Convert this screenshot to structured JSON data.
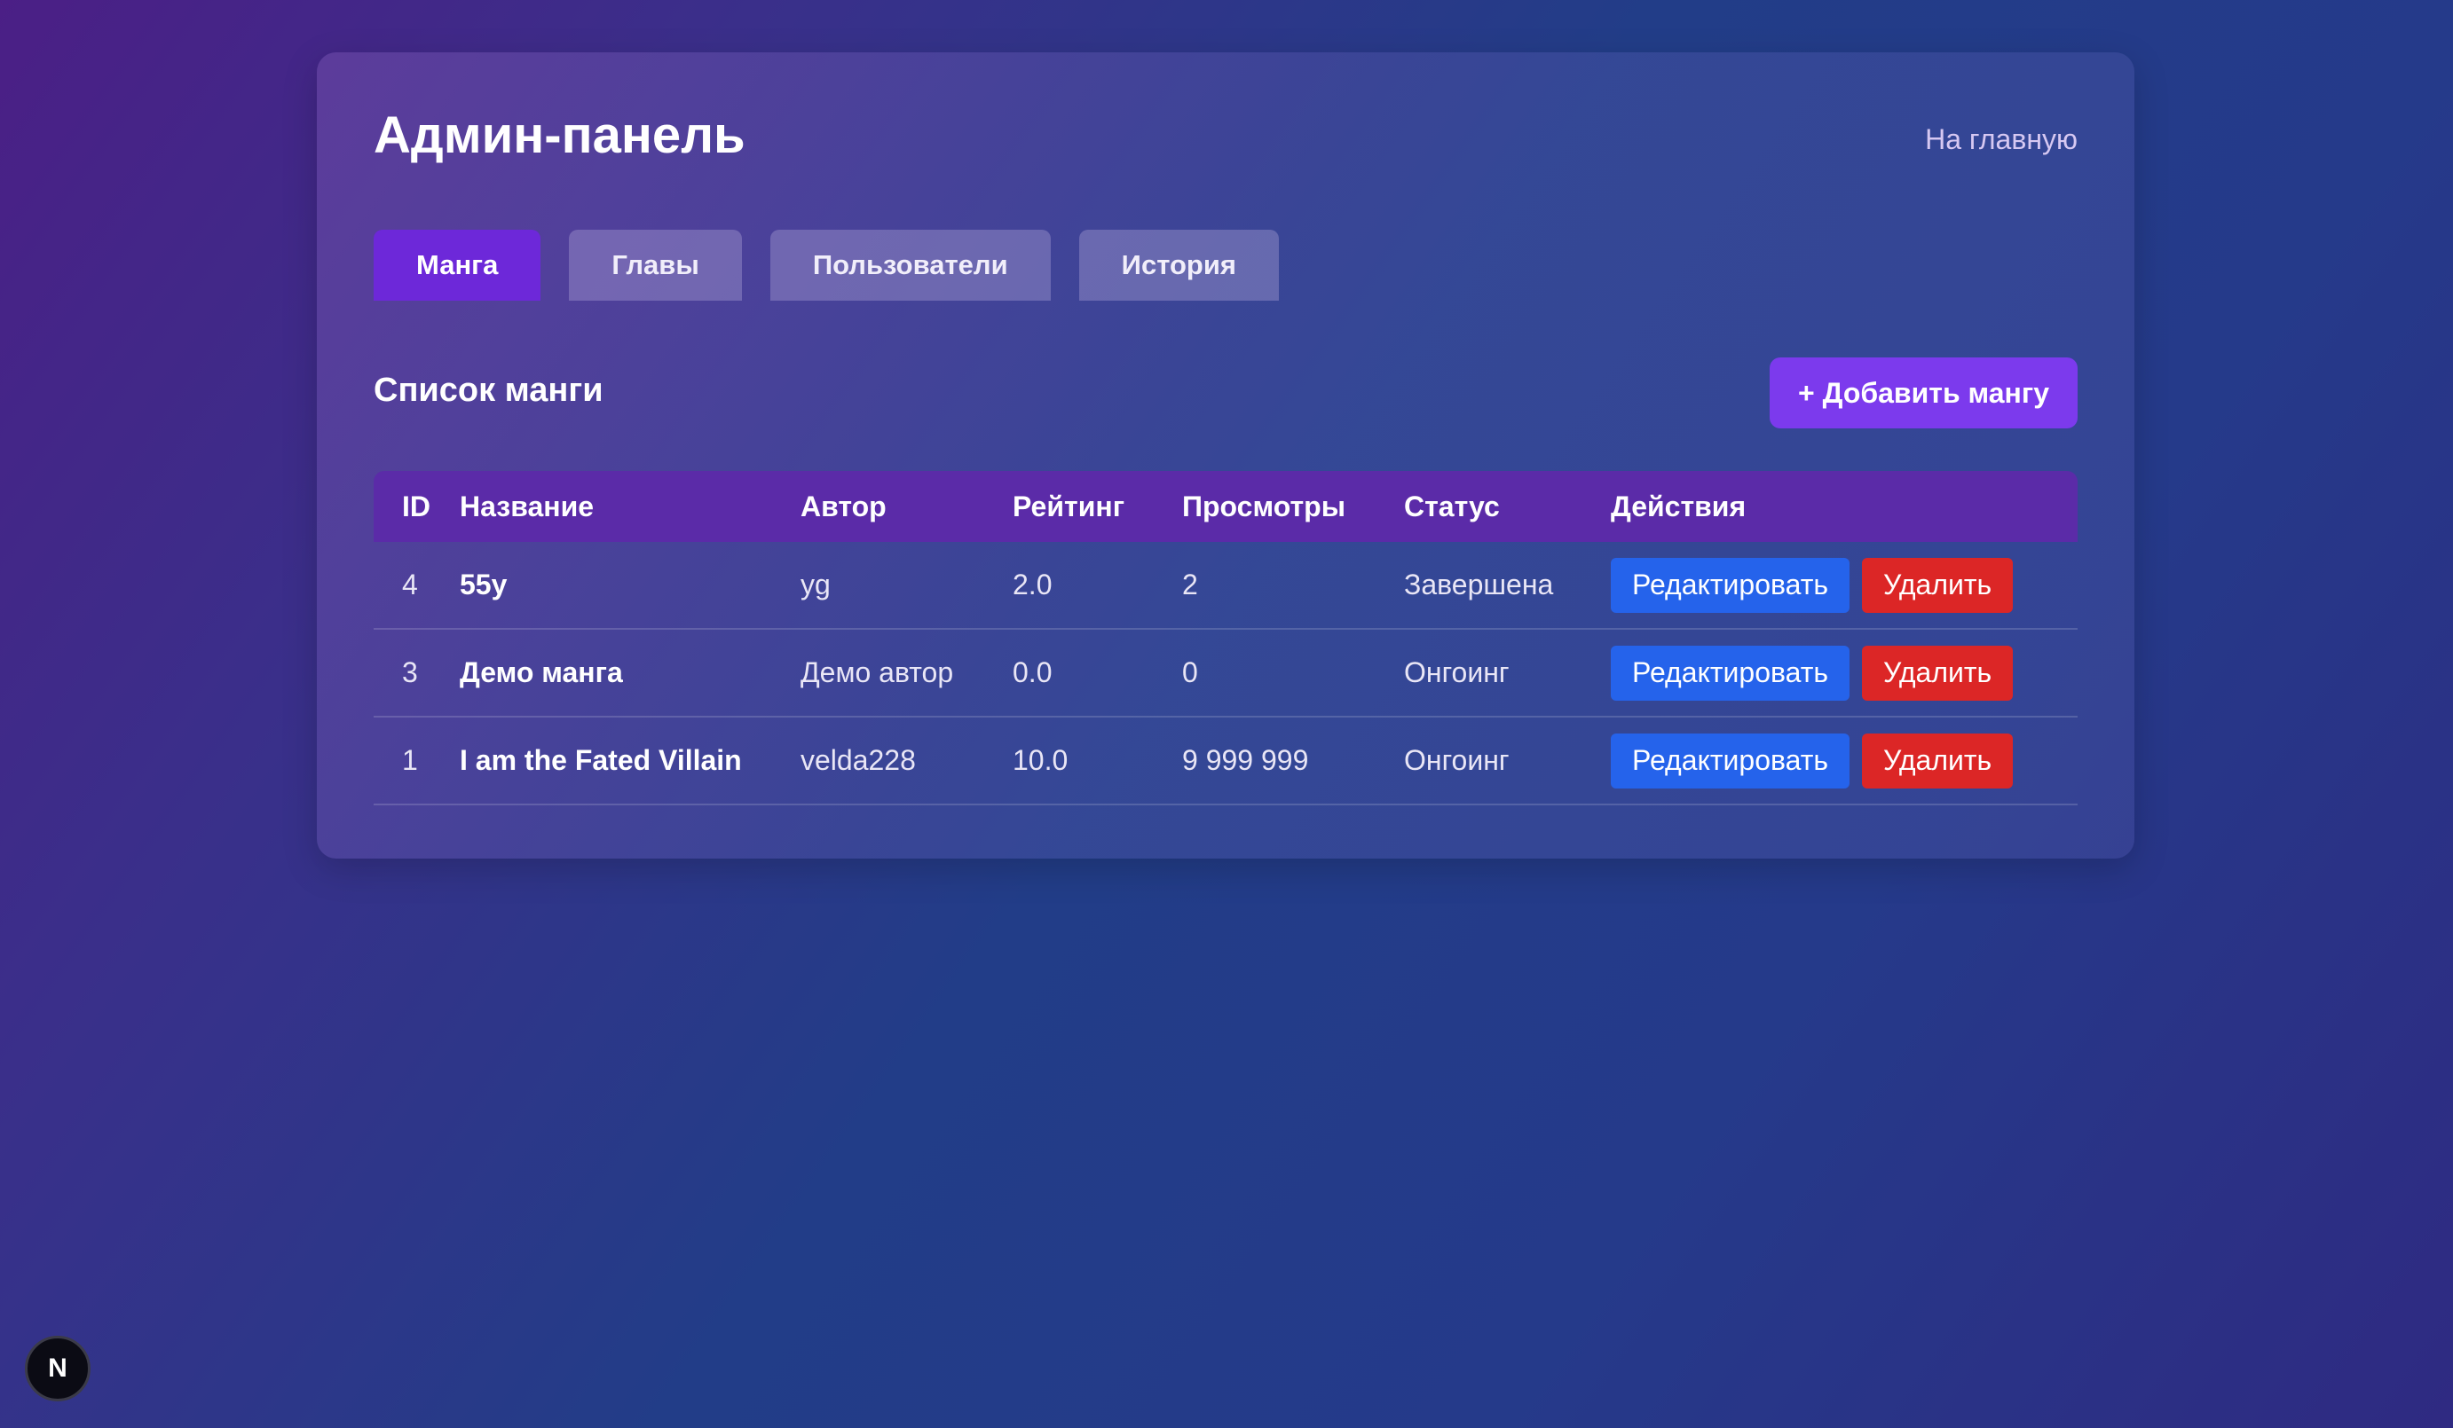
{
  "header": {
    "title": "Админ-панель",
    "home_link": "На главную"
  },
  "tabs": [
    {
      "label": "Манга",
      "active": true
    },
    {
      "label": "Главы",
      "active": false
    },
    {
      "label": "Пользователи",
      "active": false
    },
    {
      "label": "История",
      "active": false
    }
  ],
  "section": {
    "title": "Список манги",
    "add_button": "+ Добавить мангу"
  },
  "table": {
    "columns": [
      "ID",
      "Название",
      "Автор",
      "Рейтинг",
      "Просмотры",
      "Статус",
      "Действия"
    ],
    "rows": [
      {
        "id": "4",
        "name": "55y",
        "author": "yg",
        "rating": "2.0",
        "views": "2",
        "status": "Завершена",
        "edit": "Редактировать",
        "delete": "Удалить"
      },
      {
        "id": "3",
        "name": "Демо манга",
        "author": "Демо автор",
        "rating": "0.0",
        "views": "0",
        "status": "Онгоинг",
        "edit": "Редактировать",
        "delete": "Удалить"
      },
      {
        "id": "1",
        "name": "I am the Fated Villain",
        "author": "velda228",
        "rating": "10.0",
        "views": "9 999 999",
        "status": "Онгоинг",
        "edit": "Редактировать",
        "delete": "Удалить"
      }
    ]
  },
  "dev_badge": {
    "label": "N",
    "icon": "nextjs-icon"
  },
  "colors": {
    "accent": "#7c3aed",
    "active_tab": "#6d28d9",
    "table_header": "#5b2ba8",
    "edit_button": "#2563eb",
    "delete_button": "#dc2626"
  }
}
